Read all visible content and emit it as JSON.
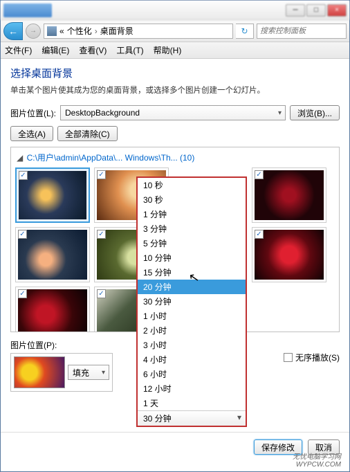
{
  "titlebar": {
    "min": "─",
    "max": "□",
    "close": "×"
  },
  "nav": {
    "back": "←",
    "fwd": "→",
    "crumb1": "«",
    "crumb2": "个性化",
    "crumb3": "桌面背景",
    "refresh": "↻",
    "search_placeholder": "搜索控制面板"
  },
  "menubar": {
    "file": "文件(F)",
    "edit": "编辑(E)",
    "view": "查看(V)",
    "tools": "工具(T)",
    "help": "帮助(H)"
  },
  "heading": "选择桌面背景",
  "desc": "单击某个图片使其成为您的桌面背景，或选择多个图片创建一个幻灯片。",
  "loc_label": "图片位置(L):",
  "loc_value": "DesktopBackground",
  "browse": "浏览(B)...",
  "select_all": "全选(A)",
  "clear_all": "全部清除(C)",
  "gallery_path": "C:\\用户\\admin\\AppData\\... Windows\\Th... (10)",
  "pos_label": "图片位置(P):",
  "fill_value": "填充",
  "interval_current": "30 分钟",
  "shuffle": "无序播放(S)",
  "save": "保存修改",
  "cancel": "取消",
  "dd_items": [
    "10 秒",
    "30 秒",
    "1 分钟",
    "3 分钟",
    "5 分钟",
    "10 分钟",
    "15 分钟",
    "20 分钟",
    "30 分钟",
    "1 小时",
    "2 小时",
    "3 小时",
    "4 小时",
    "6 小时",
    "12 小时",
    "1 天"
  ],
  "dd_hover_index": 7,
  "watermark_line1": "无忧电脑学习网",
  "watermark_line2": "WYPCW.COM"
}
